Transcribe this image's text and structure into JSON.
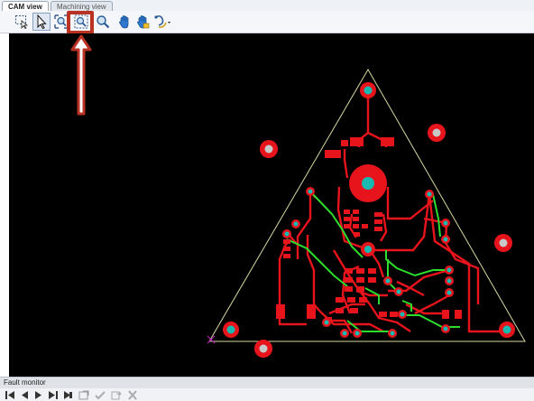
{
  "tabs": [
    {
      "label": "CAM view",
      "active": true
    },
    {
      "label": "Machining view",
      "active": false
    }
  ],
  "toolbar": {
    "buttons": [
      {
        "icon": "rectangle-select-icon"
      },
      {
        "icon": "pointer-icon"
      },
      {
        "icon": "zoom-fit-icon"
      },
      {
        "icon": "zoom-window-icon",
        "highlighted": true
      },
      {
        "icon": "zoom-icon"
      },
      {
        "icon": "pan-hand-icon"
      },
      {
        "icon": "pan-drag-icon"
      },
      {
        "icon": "route-options-icon",
        "has_dropdown": true
      }
    ]
  },
  "status": {
    "label": "Fault monitor"
  },
  "colors": {
    "copper": "#e8141c",
    "pad_hole": "#19b8b0",
    "trace_green": "#2ddc2d",
    "outline": "#d8d8a0",
    "highlight": "#b93224"
  }
}
